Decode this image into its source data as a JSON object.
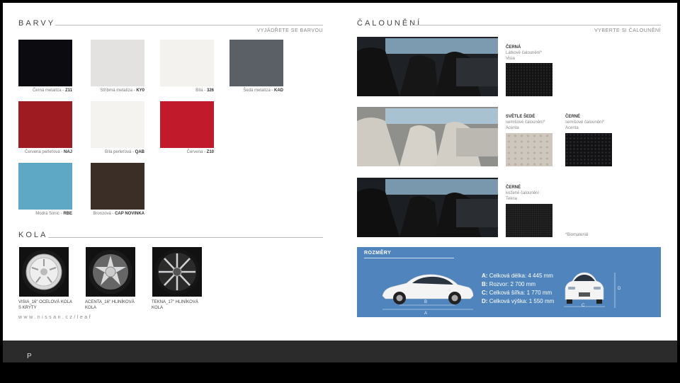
{
  "colors": {
    "title": "BARVY",
    "subtitle": "VYJÁDŘETE SE BARVOU",
    "swatches": [
      {
        "name": "Černá metalíza -",
        "code": "Z11",
        "hex": "#0b0b10"
      },
      {
        "name": "Stříbrná metalíza -",
        "code": "KY0",
        "hex": "#e3e2e0"
      },
      {
        "name": "Bílá -",
        "code": "326",
        "hex": "#f3f2ef"
      },
      {
        "name": "Šedá metalíza -",
        "code": "KAD",
        "hex": "#5b6066"
      },
      {
        "name": "Červená perleťová -",
        "code": "NAJ",
        "hex": "#9e1b22"
      },
      {
        "name": "Bílá perleťová -",
        "code": "QAB",
        "hex": "#f4f3ef"
      },
      {
        "name": "Červená -",
        "code": "Z10",
        "hex": "#c01a2b"
      },
      {
        "name": "Modrá Sonic -",
        "code": "RBE",
        "hex": "#5ea8c5"
      },
      {
        "name": "Bronzová -",
        "code": "CAP NOVINKA",
        "hex": "#3a2e26"
      }
    ]
  },
  "wheels": {
    "title": "KOLA",
    "items": [
      {
        "line1": "VISIA_16\" OCELOVÁ KOLA",
        "line2": "S KRYTY"
      },
      {
        "line1": "ACENTA_16\" HLINÍKOVÁ",
        "line2": "KOLA"
      },
      {
        "line1": "TEKNA_17\" HLINÍKOVÁ",
        "line2": "KOLA"
      }
    ],
    "url": "www.nissan.cz/leaf"
  },
  "upholstery": {
    "title": "ČALOUNĚNÍ",
    "subtitle": "VYBERTE SI ČALOUNĚNÍ",
    "trims": [
      {
        "name": "ČERNÁ",
        "desc": "Látkové čalounění*",
        "grade": "Visia",
        "hex": "#141414"
      },
      {
        "name": "SVĚTLE ŠEDÉ",
        "desc": "semišové čalounění*",
        "grade": "Acenta",
        "hex": "#cdc7bd"
      },
      {
        "name": "ČERNÉ",
        "desc": "semišové čalounění*",
        "grade": "Acenta",
        "hex": "#121214"
      },
      {
        "name": "ČERNÉ",
        "desc": "kožené čalounění",
        "grade": "Tekna",
        "hex": "#151515"
      }
    ],
    "footnote": "*Biomateriál"
  },
  "dimensions": {
    "title": "ROZMĚRY",
    "specs": [
      {
        "key": "A:",
        "text": "Celková délka: 4 445 mm"
      },
      {
        "key": "B:",
        "text": "Rozvor: 2 700 mm"
      },
      {
        "key": "C:",
        "text": "Celková šířka: 1 770 mm"
      },
      {
        "key": "D:",
        "text": "Celková výška: 1 550 mm"
      }
    ],
    "labels": {
      "a": "A",
      "b": "B",
      "c": "C",
      "d": "D"
    }
  },
  "footer": {
    "page_label": "P"
  }
}
